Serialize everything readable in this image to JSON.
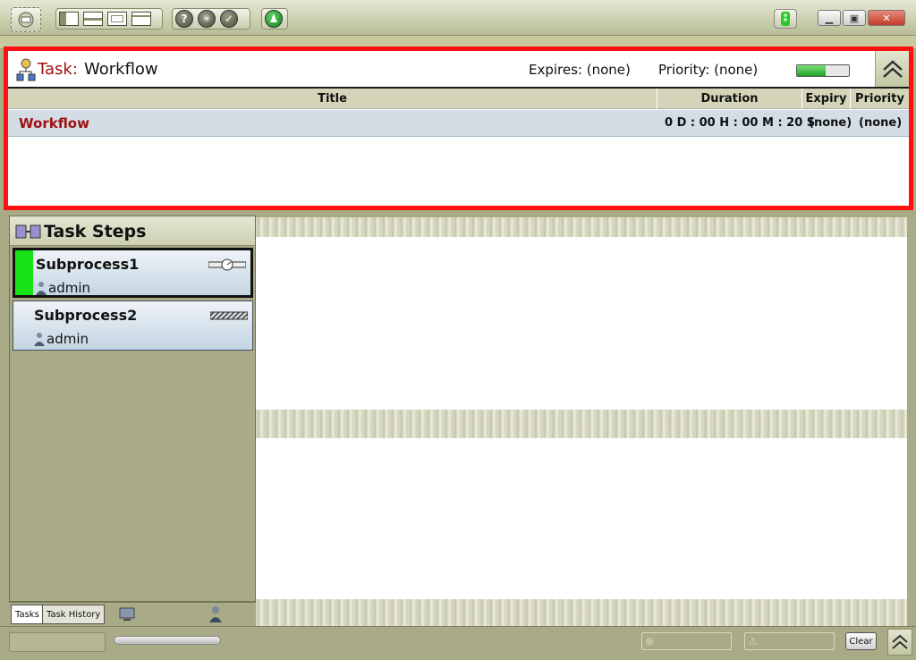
{
  "task": {
    "label": "Task:",
    "name": "Workflow",
    "expires_label": "Expires: (none)",
    "priority_label": "Priority: (none)",
    "progress": 0.55
  },
  "grid": {
    "columns": [
      "Title",
      "Duration",
      "Expiry",
      "Priority"
    ],
    "rows": [
      {
        "title": "Workflow",
        "duration": "0 D : 00 H : 00 M : 20 S",
        "expiry": "(none)",
        "priority": "(none)"
      }
    ]
  },
  "task_steps": {
    "title": "Task Steps",
    "items": [
      {
        "name": "Subprocess1",
        "user": "admin",
        "status_color": "#19e219",
        "active": true
      },
      {
        "name": "Subprocess2",
        "user": "admin",
        "status_color": "",
        "active": false
      }
    ]
  },
  "tabs": [
    "Tasks",
    "Task History"
  ],
  "statusbar": {
    "clear_label": "Clear"
  },
  "colors": {
    "accent_red": "#a01010",
    "highlight_border": "#ff0f0f",
    "panel_olive": "#a9aa86"
  }
}
